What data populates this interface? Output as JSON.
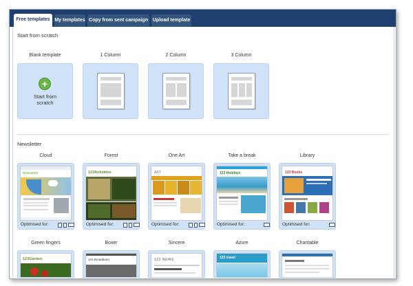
{
  "tabs": [
    {
      "label": "Free templates",
      "active": true
    },
    {
      "label": "My templates",
      "active": false
    },
    {
      "label": "Copy from sent campaign",
      "active": false
    },
    {
      "label": "Upload template",
      "active": false
    }
  ],
  "scratch": {
    "title": "Start from scratch",
    "cards": [
      {
        "label": "Blank template",
        "action_line1": "Start from",
        "action_line2": "scratch"
      },
      {
        "label": "1 Column"
      },
      {
        "label": "2 Column"
      },
      {
        "label": "3 Column"
      }
    ]
  },
  "newsletter": {
    "title": "Newsletter",
    "optimised_label": "Optimised for:",
    "templates": [
      {
        "name": "Cloud",
        "devices": [
          "tablet",
          "phone",
          "desktop"
        ],
        "brand": "Newsletter",
        "accent": "#7fbf3f"
      },
      {
        "name": "Forest",
        "devices": [
          "tablet",
          "phone",
          "desktop"
        ],
        "brand": "123Activities",
        "accent": "#6c8a2a"
      },
      {
        "name": "One Art",
        "devices": [
          "tablet",
          "phone",
          "desktop"
        ],
        "brand": "ART",
        "accent": "#e0a020"
      },
      {
        "name": "Take a break",
        "devices": [
          "desktop"
        ],
        "brand": "123 Holidays",
        "accent": "#2aa0d8"
      },
      {
        "name": "Library",
        "devices": [
          "desktop"
        ],
        "brand": "123 Books",
        "accent": "#2d6fb5"
      }
    ],
    "row2": [
      {
        "name": "Green fingers",
        "brand": "123Garden"
      },
      {
        "name": "Boxer",
        "brand": "123 Broadband"
      },
      {
        "name": "Sincere",
        "brand": "123 NEWS"
      },
      {
        "name": "Azure",
        "brand": "123 travel"
      },
      {
        "name": "Charitable",
        "brand": ""
      }
    ]
  }
}
